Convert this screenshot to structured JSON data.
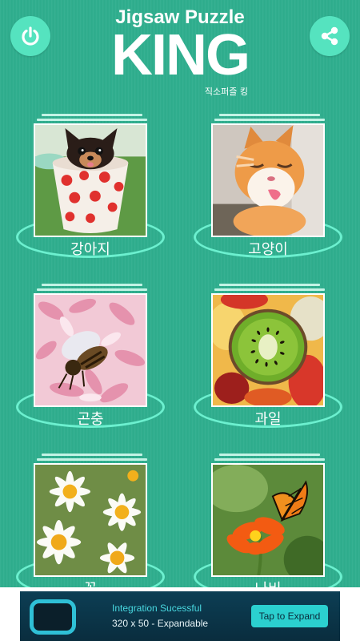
{
  "header": {
    "logo_line1": "Jigsaw Puzzle",
    "logo_line2": "KING",
    "logo_subtitle": "직소퍼즐 킹",
    "power_icon": "power-icon",
    "share_icon": "share-icon"
  },
  "categories": [
    {
      "label": "강아지",
      "image": "puppy-in-polka-dot-cup"
    },
    {
      "label": "고양이",
      "image": "orange-cat-licking"
    },
    {
      "label": "곤충",
      "image": "bee-on-pink-flower"
    },
    {
      "label": "과일",
      "image": "kiwi-and-fruits"
    },
    {
      "label": "꽃",
      "image": "white-daisies"
    },
    {
      "label": "나비",
      "image": "monarch-butterfly-on-orange-flower"
    }
  ],
  "ad": {
    "title": "Integration Sucessful",
    "subtitle": "320 x 50 - Expandable",
    "button_label": "Tap to Expand"
  },
  "colors": {
    "background": "#2fae8e",
    "accent": "#55e3bf",
    "ring": "#6cf0cf"
  }
}
